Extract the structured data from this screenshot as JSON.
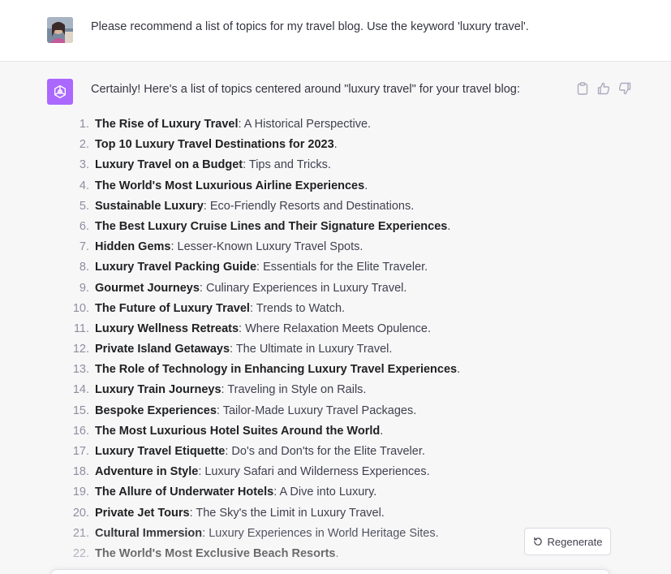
{
  "user": {
    "message": "Please recommend a list of topics for my travel blog. Use the keyword 'luxury travel'."
  },
  "assistant": {
    "intro": "Certainly! Here's a list of topics centered around \"luxury travel\" for your travel blog:",
    "topics": [
      {
        "num": "1.",
        "title": "The Rise of Luxury Travel",
        "rest": ": A Historical Perspective."
      },
      {
        "num": "2.",
        "title": "Top 10 Luxury Travel Destinations for 2023",
        "rest": "."
      },
      {
        "num": "3.",
        "title": "Luxury Travel on a Budget",
        "rest": ": Tips and Tricks."
      },
      {
        "num": "4.",
        "title": "The World's Most Luxurious Airline Experiences",
        "rest": "."
      },
      {
        "num": "5.",
        "title": "Sustainable Luxury",
        "rest": ": Eco-Friendly Resorts and Destinations."
      },
      {
        "num": "6.",
        "title": "The Best Luxury Cruise Lines and Their Signature Experiences",
        "rest": "."
      },
      {
        "num": "7.",
        "title": "Hidden Gems",
        "rest": ": Lesser-Known Luxury Travel Spots."
      },
      {
        "num": "8.",
        "title": "Luxury Travel Packing Guide",
        "rest": ": Essentials for the Elite Traveler."
      },
      {
        "num": "9.",
        "title": "Gourmet Journeys",
        "rest": ": Culinary Experiences in Luxury Travel."
      },
      {
        "num": "10.",
        "title": "The Future of Luxury Travel",
        "rest": ": Trends to Watch."
      },
      {
        "num": "11.",
        "title": "Luxury Wellness Retreats",
        "rest": ": Where Relaxation Meets Opulence."
      },
      {
        "num": "12.",
        "title": "Private Island Getaways",
        "rest": ": The Ultimate in Luxury Travel."
      },
      {
        "num": "13.",
        "title": "The Role of Technology in Enhancing Luxury Travel Experiences",
        "rest": "."
      },
      {
        "num": "14.",
        "title": "Luxury Train Journeys",
        "rest": ": Traveling in Style on Rails."
      },
      {
        "num": "15.",
        "title": "Bespoke Experiences",
        "rest": ": Tailor-Made Luxury Travel Packages."
      },
      {
        "num": "16.",
        "title": "The Most Luxurious Hotel Suites Around the World",
        "rest": "."
      },
      {
        "num": "17.",
        "title": "Luxury Travel Etiquette",
        "rest": ": Do's and Don'ts for the Elite Traveler."
      },
      {
        "num": "18.",
        "title": "Adventure in Style",
        "rest": ": Luxury Safari and Wilderness Experiences."
      },
      {
        "num": "19.",
        "title": "The Allure of Underwater Hotels",
        "rest": ": A Dive into Luxury."
      },
      {
        "num": "20.",
        "title": "Private Jet Tours",
        "rest": ": The Sky's the Limit in Luxury Travel."
      },
      {
        "num": "21.",
        "title": "Cultural Immersion",
        "rest": ": Luxury Experiences in World Heritage Sites."
      },
      {
        "num": "22.",
        "title": "The World's Most Exclusive Beach Resorts",
        "rest": "."
      }
    ]
  },
  "actions": {
    "copy_icon": "clipboard-icon",
    "like_icon": "thumbs-up-icon",
    "dislike_icon": "thumbs-down-icon"
  },
  "regenerate": {
    "label": "Regenerate",
    "icon": "refresh-icon"
  },
  "colors": {
    "bot_avatar": "#ab68ff",
    "assistant_bg": "#f7f7f8",
    "user_bg": "#ffffff"
  }
}
